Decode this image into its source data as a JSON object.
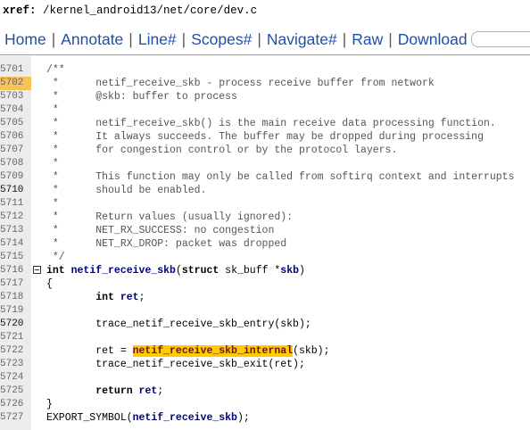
{
  "xref": {
    "label": "xref:",
    "path": "/kernel_android13/net/core/dev.c"
  },
  "menu": {
    "items": [
      "Home",
      "Annotate",
      "Line#",
      "Scopes#",
      "Navigate#",
      "Raw",
      "Download"
    ],
    "separator": "|"
  },
  "code": {
    "lines": [
      {
        "n": "5701",
        "t": "/**"
      },
      {
        "n": "5702",
        "t": " *      netif_receive_skb - process receive buffer from network",
        "hl": true
      },
      {
        "n": "5703",
        "t": " *      @skb: buffer to process"
      },
      {
        "n": "5704",
        "t": " *"
      },
      {
        "n": "5705",
        "t": " *      netif_receive_skb() is the main receive data processing function."
      },
      {
        "n": "5706",
        "t": " *      It always succeeds. The buffer may be dropped during processing"
      },
      {
        "n": "5707",
        "t": " *      for congestion control or by the protocol layers."
      },
      {
        "n": "5708",
        "t": " *"
      },
      {
        "n": "5709",
        "t": " *      This function may only be called from softirq context and interrupts"
      },
      {
        "n": "5710",
        "t": " *      should be enabled.",
        "dark": true
      },
      {
        "n": "5711",
        "t": " *"
      },
      {
        "n": "5712",
        "t": " *      Return values (usually ignored):"
      },
      {
        "n": "5713",
        "t": " *      NET_RX_SUCCESS: no congestion"
      },
      {
        "n": "5714",
        "t": " *      NET_RX_DROP: packet was dropped"
      },
      {
        "n": "5715",
        "t": " */"
      },
      {
        "n": "5716",
        "t": "int netif_receive_skb(struct sk_buff *skb)"
      },
      {
        "n": "5717",
        "t": "{"
      },
      {
        "n": "5718",
        "t": "        int ret;"
      },
      {
        "n": "5719",
        "t": ""
      },
      {
        "n": "5720",
        "t": "        trace_netif_receive_skb_entry(skb);",
        "dark": true
      },
      {
        "n": "5721",
        "t": ""
      },
      {
        "n": "5722",
        "t": "        ret = netif_receive_skb_internal(skb);"
      },
      {
        "n": "5723",
        "t": "        trace_netif_receive_skb_exit(ret);"
      },
      {
        "n": "5724",
        "t": ""
      },
      {
        "n": "5725",
        "t": "        return ret;"
      },
      {
        "n": "5726",
        "t": "}"
      },
      {
        "n": "5727",
        "t": "EXPORT_SYMBOL(netif_receive_skb);"
      }
    ],
    "highlight_word": "netif_receive_skb_internal"
  },
  "colors": {
    "menu_link": "#1f4fa8",
    "line_highlight": "#f5c35a",
    "search_highlight": "#ffcc00",
    "function_name": "#000080",
    "comment": "#555555"
  }
}
